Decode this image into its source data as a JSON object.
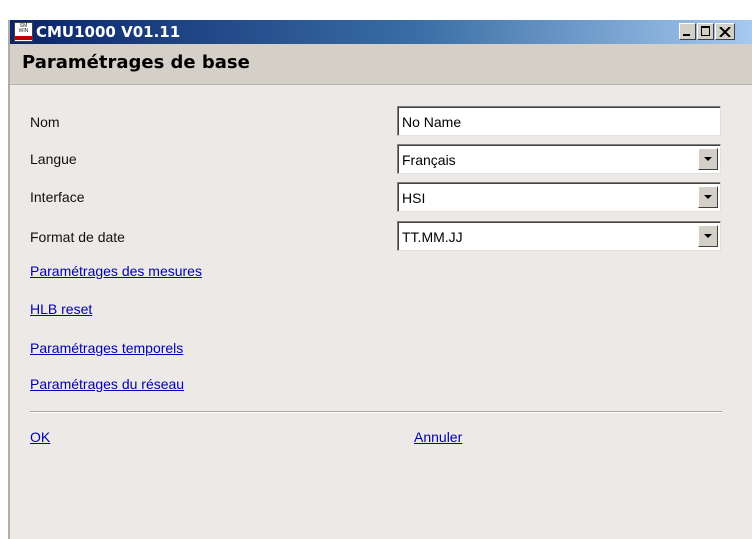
{
  "window": {
    "title": "CMU1000 V01.11",
    "icon_text": "SM WIN"
  },
  "section_title": "Paramétrages de base",
  "form": {
    "name_label": "Nom",
    "name_value": "No Name",
    "language_label": "Langue",
    "language_value": "Français",
    "interface_label": "Interface",
    "interface_value": "HSI",
    "date_format_label": "Format de date",
    "date_format_value": "TT.MM.JJ"
  },
  "links": {
    "measures": "Paramétrages des mesures",
    "hlb_reset": "HLB reset",
    "time_settings": "Paramétrages temporels",
    "network": "Paramétrages du réseau"
  },
  "footer": {
    "ok": "OK",
    "cancel": "Annuler"
  },
  "colors": {
    "titlebar_start": "#0a246a",
    "titlebar_end": "#a6caf0",
    "background": "#ece9e6",
    "link": "#0000b8"
  },
  "icons": [
    "app-icon",
    "minimize-icon",
    "maximize-icon",
    "close-icon",
    "dropdown-arrow-icon"
  ]
}
